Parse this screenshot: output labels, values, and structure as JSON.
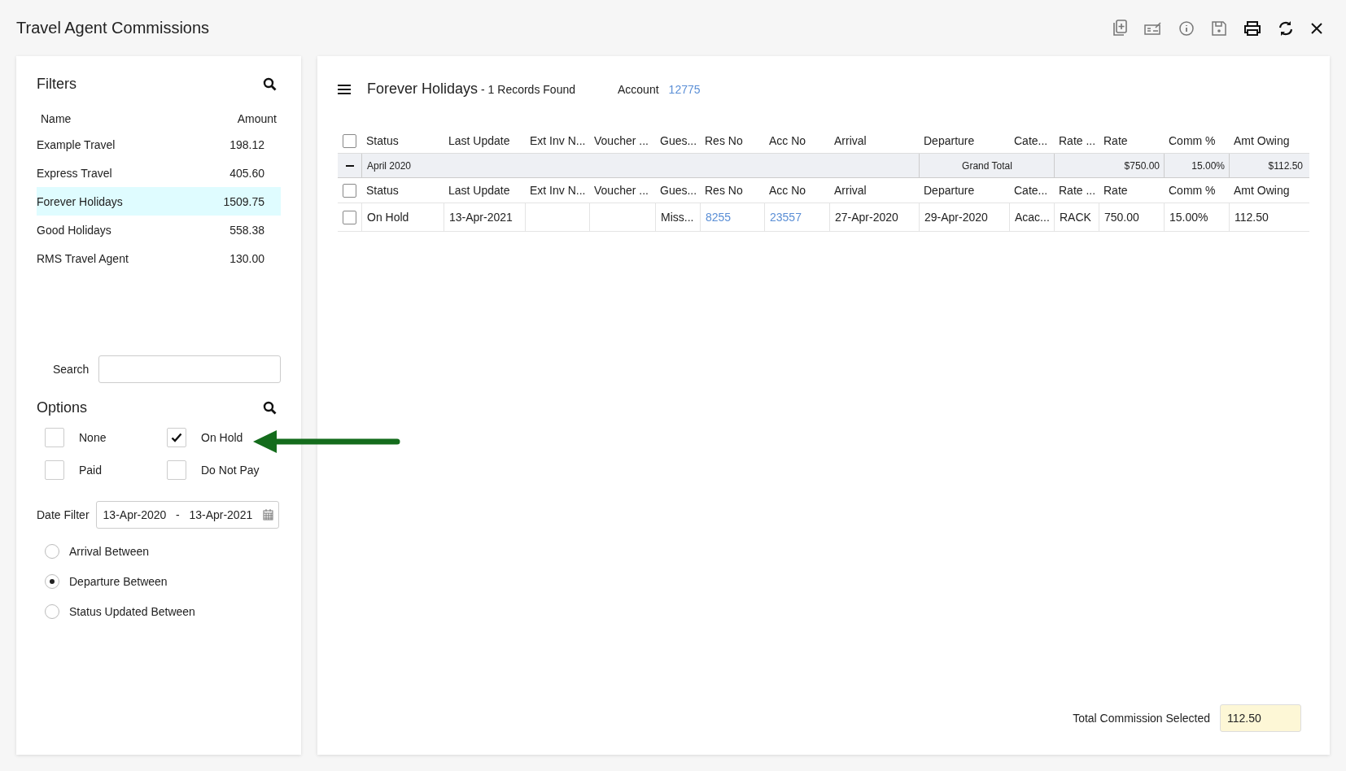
{
  "window": {
    "title": "Travel Agent Commissions"
  },
  "filters": {
    "title": "Filters",
    "columns": [
      "Name",
      "Amount"
    ],
    "agents": [
      {
        "name": "Example Travel",
        "amount": "198.12",
        "selected": false
      },
      {
        "name": "Express Travel",
        "amount": "405.60",
        "selected": false
      },
      {
        "name": "Forever Holidays",
        "amount": "1509.75",
        "selected": true
      },
      {
        "name": "Good Holidays",
        "amount": "558.38",
        "selected": false
      },
      {
        "name": "RMS Travel Agent",
        "amount": "130.00",
        "selected": false
      }
    ],
    "search_label": "Search"
  },
  "options": {
    "title": "Options",
    "checkboxes": [
      {
        "label": "None",
        "checked": false
      },
      {
        "label": "On Hold",
        "checked": true
      },
      {
        "label": "Paid",
        "checked": false
      },
      {
        "label": "Do Not Pay",
        "checked": false
      }
    ],
    "date_filter": {
      "label": "Date Filter",
      "from": "13-Apr-2020",
      "separator": "-",
      "to": "13-Apr-2021"
    },
    "radios": [
      {
        "label": "Arrival Between",
        "selected": false
      },
      {
        "label": "Departure Between",
        "selected": true
      },
      {
        "label": "Status Updated Between",
        "selected": false
      }
    ]
  },
  "main": {
    "agent": "Forever Holidays",
    "records": "- 1 Records Found",
    "account_label": "Account",
    "account": "12775",
    "header": {
      "checked": false,
      "labels": [
        "Status",
        "Last Update",
        "Ext Inv N...",
        "Voucher ...",
        "Gues...",
        "Res No",
        "Acc No",
        "Arrival",
        "Departure",
        "Cate...",
        "Rate ...",
        "Rate",
        "Comm %",
        "Amt Owing"
      ]
    },
    "group": {
      "label": "April 2020",
      "expanded": true,
      "total_label": "Grand Total",
      "rate_total": "$750.00",
      "comm": "15.00%",
      "amt_owing": "$112.50"
    },
    "subheader": {
      "checked": false,
      "labels": [
        "Status",
        "Last Update",
        "Ext Inv N...",
        "Voucher ...",
        "Gues...",
        "Res No",
        "Acc No",
        "Arrival",
        "Departure",
        "Cate...",
        "Rate ...",
        "Rate",
        "Comm %",
        "Amt Owing"
      ]
    },
    "rows": [
      {
        "selected": false,
        "cells": [
          {
            "kind": "text",
            "text": "On Hold"
          },
          {
            "kind": "text",
            "text": "13-Apr-2021"
          },
          {
            "kind": "blank"
          },
          {
            "kind": "blank"
          },
          {
            "kind": "text",
            "text": "Miss..."
          },
          {
            "kind": "link",
            "text": "8255"
          },
          {
            "kind": "link",
            "text": "23557"
          },
          {
            "kind": "text",
            "text": "27-Apr-2020"
          },
          {
            "kind": "text",
            "text": "29-Apr-2020"
          },
          {
            "kind": "text",
            "text": "Acac..."
          },
          {
            "kind": "text",
            "text": "RACK"
          },
          {
            "kind": "text",
            "text": "750.00"
          },
          {
            "kind": "text",
            "text": "15.00%"
          },
          {
            "kind": "text",
            "text": "112.50"
          }
        ]
      }
    ],
    "total_label": "Total Commission Selected",
    "total": "112.50"
  }
}
